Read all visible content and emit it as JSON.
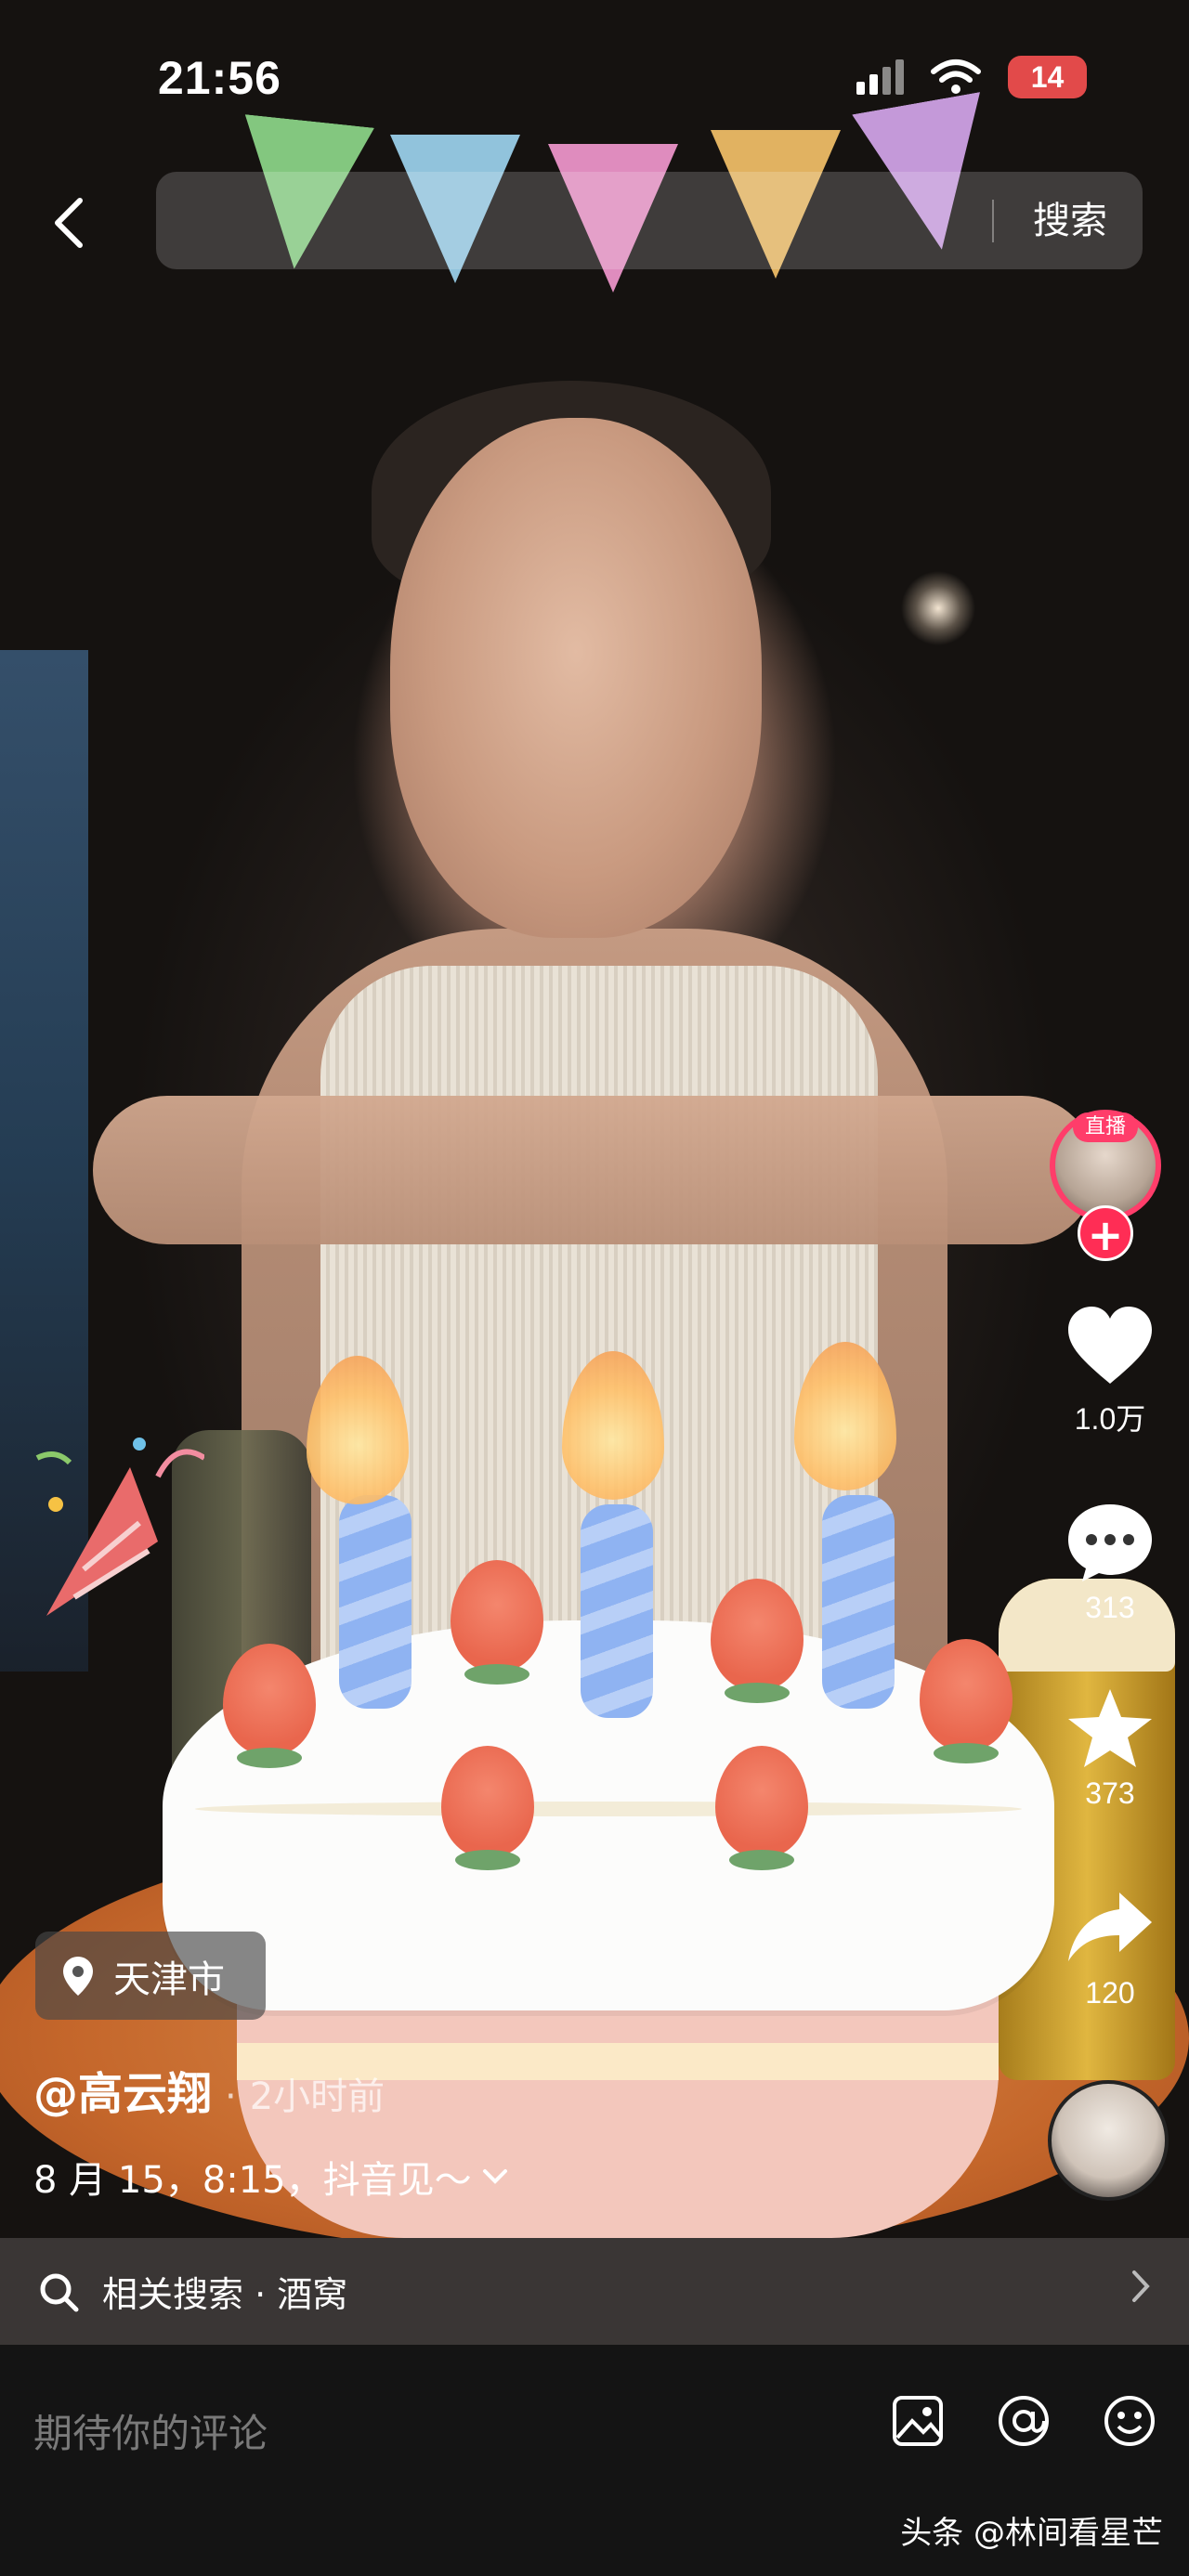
{
  "status_bar": {
    "time": "21:56",
    "battery": "14"
  },
  "header": {
    "search_button": "搜索"
  },
  "right_rail": {
    "live_label": "直播",
    "like_count": "1.0万",
    "comment_count": "313",
    "favorite_count": "373",
    "share_count": "120"
  },
  "post": {
    "location": "天津市",
    "author": "@高云翔",
    "time": "2小时前",
    "caption": "8 月 15，8:15，抖音见～"
  },
  "related_search": {
    "label": "相关搜索 · 酒窝"
  },
  "comment": {
    "placeholder": "期待你的评论"
  },
  "watermark": "头条 @林间看星芒",
  "colors": {
    "accent": "#ff2d55",
    "battery_low": "#e24a4a"
  }
}
